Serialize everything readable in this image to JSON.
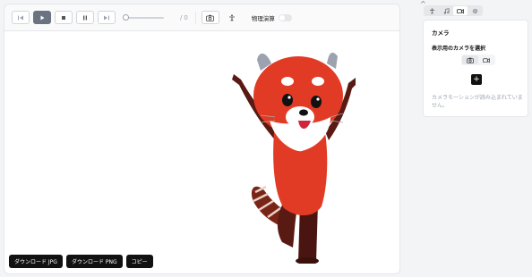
{
  "toolbar": {
    "frame_current": "",
    "frame_separator": "/",
    "frame_total": "0",
    "physics_label": "物理演算",
    "physics_enabled": false,
    "playing": false,
    "seek_progress": 0
  },
  "actions": {
    "download_jpg": "ダウンロード JPG",
    "download_png": "ダウンロード PNG",
    "copy": "コピー"
  },
  "side_panel": {
    "tabs": [
      "person-icon",
      "music-icon",
      "video-camera-icon",
      "gear-icon"
    ],
    "active_tab": 2,
    "title": "カメラ",
    "subtitle": "表示用のカメラを選択",
    "camera_modes": [
      "camera-icon",
      "video-camera-icon"
    ],
    "active_mode": 0,
    "add_label": "+",
    "note": "カメラモーションが読み込まれていません。"
  },
  "colors": {
    "accent_dark": "#111111",
    "panda_red": "#e23b25",
    "panda_dark": "#5a1a14"
  }
}
